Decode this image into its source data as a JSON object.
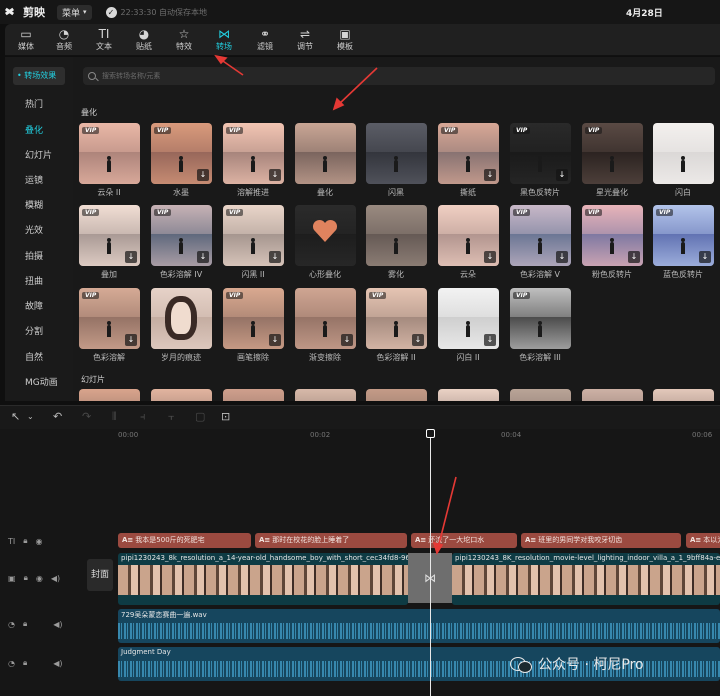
{
  "app": {
    "name": "剪映",
    "menu_label": "菜单",
    "save_status": "22:33:30 自动保存本地",
    "date": "4月28日"
  },
  "toolbar": {
    "tabs": [
      {
        "label": "媒体",
        "icon": "media-icon"
      },
      {
        "label": "音频",
        "icon": "audio-icon"
      },
      {
        "label": "文本",
        "icon": "text-icon"
      },
      {
        "label": "贴纸",
        "icon": "sticker-icon"
      },
      {
        "label": "特效",
        "icon": "effects-icon"
      },
      {
        "label": "转场",
        "icon": "transition-icon",
        "active": true
      },
      {
        "label": "滤镜",
        "icon": "filter-icon"
      },
      {
        "label": "调节",
        "icon": "adjust-icon"
      },
      {
        "label": "模板",
        "icon": "template-icon"
      }
    ]
  },
  "sidebar": {
    "header": "• 转场效果",
    "items": [
      "热门",
      "叠化",
      "幻灯片",
      "运镜",
      "模糊",
      "光效",
      "拍摄",
      "扭曲",
      "故障",
      "分割",
      "自然",
      "MG动画"
    ],
    "active": "叠化"
  },
  "search": {
    "placeholder": "搜索转场名称/元素"
  },
  "sections": {
    "dissolve": "叠化",
    "slideshow": "幻灯片"
  },
  "vip_label": "VIP",
  "transitions": [
    {
      "label": "云朵 II",
      "vip": true,
      "download": false
    },
    {
      "label": "水墨",
      "vip": true,
      "download": true
    },
    {
      "label": "溶解推进",
      "vip": true,
      "download": true
    },
    {
      "label": "叠化",
      "vip": false,
      "download": false
    },
    {
      "label": "闪黑",
      "vip": false,
      "download": false
    },
    {
      "label": "撕纸",
      "vip": true,
      "download": true
    },
    {
      "label": "黑色反转片",
      "vip": true,
      "download": true
    },
    {
      "label": "星光叠化",
      "vip": true,
      "download": false
    },
    {
      "label": "闪白",
      "vip": false,
      "download": false
    },
    {
      "label": "叠加",
      "vip": true,
      "download": true
    },
    {
      "label": "色彩溶解 IV",
      "vip": true,
      "download": true
    },
    {
      "label": "闪黑 II",
      "vip": true,
      "download": true
    },
    {
      "label": "心形叠化",
      "vip": false,
      "download": false
    },
    {
      "label": "雾化",
      "vip": false,
      "download": false
    },
    {
      "label": "云朵",
      "vip": false,
      "download": true
    },
    {
      "label": "色彩溶解 V",
      "vip": true,
      "download": true
    },
    {
      "label": "粉色反转片",
      "vip": true,
      "download": true
    },
    {
      "label": "蓝色反转片",
      "vip": true,
      "download": true
    },
    {
      "label": "色彩溶解",
      "vip": true,
      "download": true
    },
    {
      "label": "岁月的痕迹",
      "vip": false,
      "download": false
    },
    {
      "label": "画笔擦除",
      "vip": true,
      "download": true
    },
    {
      "label": "渐变擦除",
      "vip": false,
      "download": true
    },
    {
      "label": "色彩溶解 II",
      "vip": true,
      "download": true
    },
    {
      "label": "闪白 II",
      "vip": false,
      "download": true
    },
    {
      "label": "色彩溶解 III",
      "vip": true,
      "download": false
    }
  ],
  "timeline": {
    "ruler": [
      "00:00",
      "00:02",
      "00:04",
      "00:06"
    ],
    "cover_label": "封面",
    "text_clips": [
      "我本是500斤的死肥宅",
      "那时在校花的脸上睡着了",
      "还流了一大坨口水",
      "班里的男同学对我咬牙切齿",
      "本以为"
    ],
    "video_clips": [
      "pipi1230243_8k_resolution_a_14-year-old_handsome_boy_with_short_cec34fd8-9638-",
      "pipi1230243_8K_resolution_movie-level_lighting_indoor_villa_a_1_9bff84a-ed"
    ],
    "audio_clips": [
      "729吴朵蒙恋赛曲一遍.wav",
      "Judgment Day"
    ]
  },
  "watermark": "公众号 · 柯尼Pro",
  "colors": {
    "accent": "#22cfe0",
    "text_clip": "#9b4a40",
    "video_clip": "#0e3b44",
    "audio_clip": "#16465e",
    "arrow": "#e53935"
  }
}
